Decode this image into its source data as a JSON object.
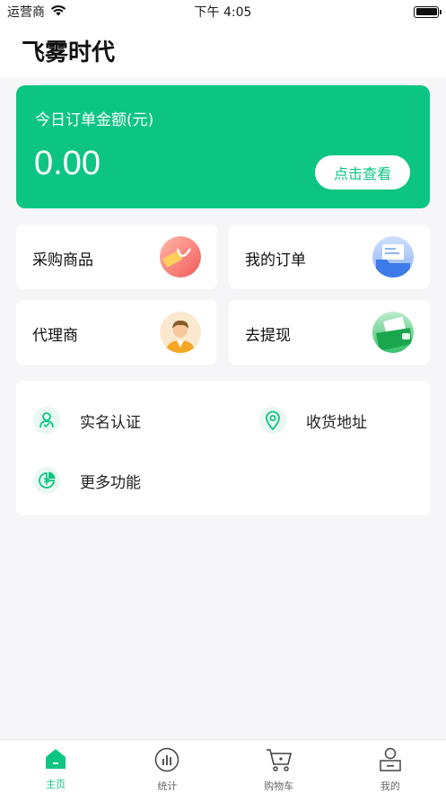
{
  "status_bar": {
    "carrier": "运营商",
    "time": "下午 4:05"
  },
  "header": {
    "title": "飞雾时代"
  },
  "order_card": {
    "label": "今日订单金额(元)",
    "amount": "0.00",
    "view_button": "点击查看"
  },
  "tiles": {
    "purchase": "采购商品",
    "my_orders": "我的订单",
    "agent": "代理商",
    "withdraw": "去提现"
  },
  "functions": {
    "real_name": "实名认证",
    "address": "收货地址",
    "more": "更多功能"
  },
  "tabbar": {
    "home": "主页",
    "stats": "统计",
    "cart": "购物车",
    "mine": "我的"
  },
  "colors": {
    "accent": "#0dc583",
    "background": "#f6f6f8"
  }
}
